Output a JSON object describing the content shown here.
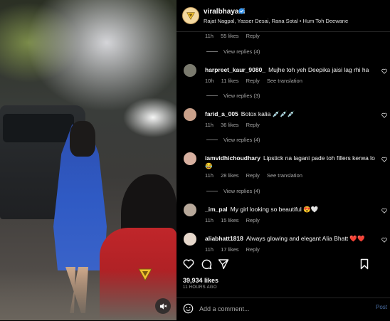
{
  "post": {
    "username": "viralbhayani",
    "subline": "Rajat Nagpal, Yasser Desai, Rana Sotal • Hum Toh Deewane"
  },
  "top_meta": {
    "time": "11h",
    "likes": "55 likes",
    "reply": "Reply"
  },
  "comments": [
    {
      "user": "harpreet_kaur_9080_",
      "text": "Mujhe toh yeh Deepika jaisi lag rhi ha",
      "time": "10h",
      "likes": "11 likes",
      "reply": "Reply",
      "translate": "See translation",
      "avatar_color": "#7a7a6e"
    },
    {
      "user": "farid_a_005",
      "text": "Botox kalia 💉💉💉",
      "time": "11h",
      "likes": "36 likes",
      "reply": "Reply",
      "translate": "",
      "avatar_color": "#c9a08a"
    },
    {
      "user": "iamvidhichoudhary",
      "text": "Lipstick na lagani pade toh fillers kerwa lo",
      "emoji": "😂",
      "time": "11h",
      "likes": "28 likes",
      "reply": "Reply",
      "translate": "See translation",
      "avatar_color": "#d7b0a0"
    },
    {
      "user": "_im_pal",
      "text": "My girl looking so beautiful 😍🤍",
      "time": "11h",
      "likes": "15 likes",
      "reply": "Reply",
      "translate": "",
      "avatar_color": "#b7a89a"
    },
    {
      "user": "aliabhatt1818",
      "text": "Always glowing and elegant Alia Bhatt ❤️❤️",
      "time": "11h",
      "likes": "17 likes",
      "reply": "Reply",
      "translate": "",
      "avatar_color": "#e6d8cc"
    }
  ],
  "view_replies": [
    "View replies (4)",
    "View replies (3)",
    "View replies (4)",
    "View replies (4)"
  ],
  "likes_count": "39,934 likes",
  "posted_ago": "11 HOURS AGO",
  "add_comment_placeholder": "Add a comment...",
  "post_label": "Post",
  "colors": {
    "accent": "#4a6fa5",
    "brand_logo": "#f2c230",
    "verified": "#3897f0"
  },
  "icons": [
    "verified-icon",
    "heart-icon",
    "comment-icon",
    "share-icon",
    "bookmark-icon",
    "emoji-icon",
    "mute-icon",
    "logo-icon"
  ]
}
